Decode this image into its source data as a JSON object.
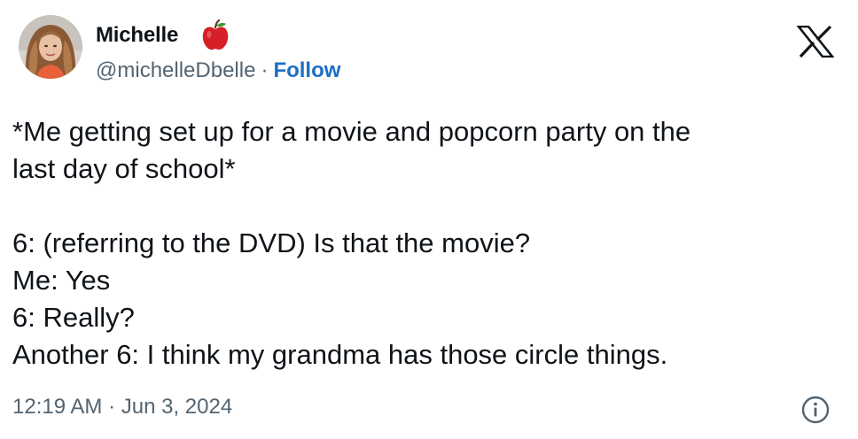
{
  "author": {
    "name": "Michelle",
    "badge_icon": "apple-icon",
    "handle": "@michelleDbelle",
    "separator": "·",
    "follow_label": "Follow"
  },
  "brand_logo": "x-logo",
  "tweet": {
    "lines": [
      "*Me getting set up for a movie and popcorn party on the",
      "last day of school*",
      "",
      "6: (referring to the DVD) Is that the movie?",
      "Me: Yes",
      "6: Really?",
      "Another 6: I think my grandma has those circle things."
    ],
    "timestamp": "12:19 AM · Jun 3, 2024"
  },
  "info_icon": "info-icon",
  "colors": {
    "text": "#0f1419",
    "secondary": "#536471",
    "link": "#1d6fc4",
    "apple": "#d61f26"
  }
}
